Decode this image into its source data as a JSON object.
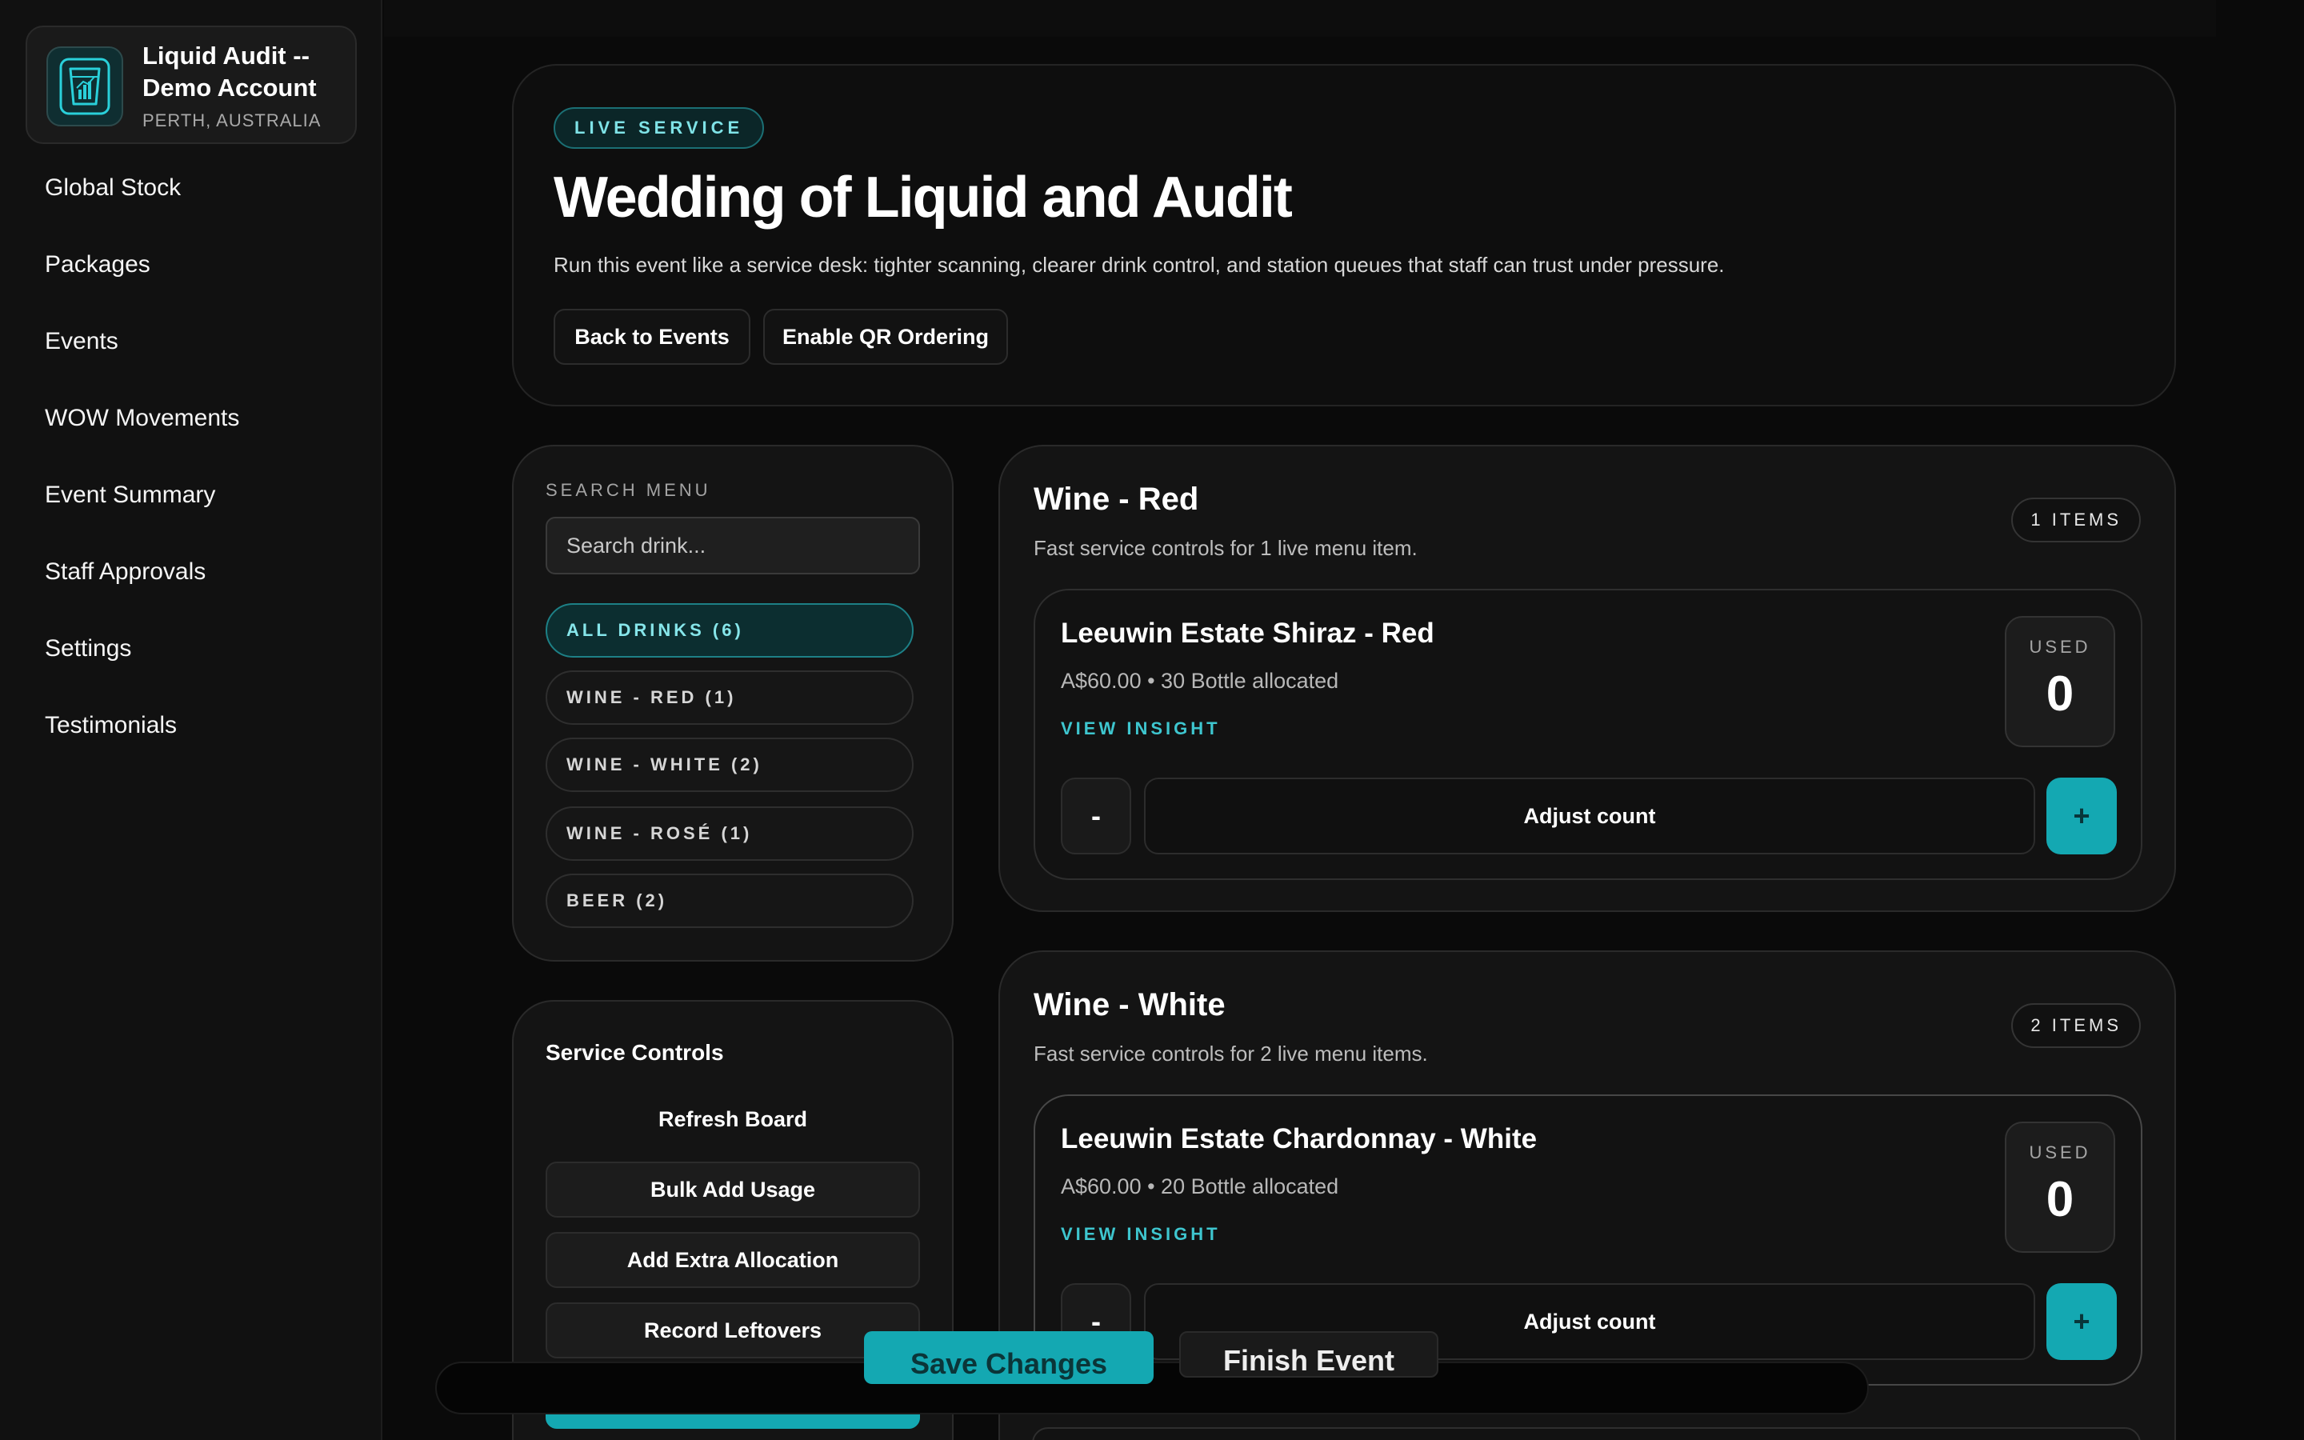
{
  "brand": {
    "name": "Liquid Audit -- Demo Account",
    "location": "PERTH, AUSTRALIA",
    "logo_icon": "glass-chart-icon"
  },
  "nav": {
    "items": [
      {
        "label": "Global Stock"
      },
      {
        "label": "Packages"
      },
      {
        "label": "Events"
      },
      {
        "label": "WOW Movements"
      },
      {
        "label": "Event Summary"
      },
      {
        "label": "Staff Approvals"
      },
      {
        "label": "Settings"
      },
      {
        "label": "Testimonials"
      }
    ]
  },
  "hero": {
    "badge": "LIVE SERVICE",
    "title": "Wedding of Liquid and Audit",
    "subtitle": "Run this event like a service desk: tighter scanning, clearer drink control, and station queues that staff can trust under pressure.",
    "back_label": "Back to Events",
    "qr_label": "Enable QR Ordering"
  },
  "search": {
    "label": "SEARCH MENU",
    "placeholder": "Search drink...",
    "categories": [
      {
        "label": "ALL DRINKS (6)",
        "active": true
      },
      {
        "label": "WINE - RED (1)"
      },
      {
        "label": "WINE - WHITE (2)"
      },
      {
        "label": "WINE - ROSÉ (1)"
      },
      {
        "label": "BEER (2)"
      }
    ]
  },
  "service": {
    "title": "Service Controls",
    "refresh": "Refresh Board",
    "bulk_add": "Bulk Add Usage",
    "extra_alloc": "Add Extra Allocation",
    "leftovers": "Record Leftovers"
  },
  "sections": [
    {
      "title": "Wine - Red",
      "subtitle": "Fast service controls for 1 live menu item.",
      "count": "1 ITEMS",
      "items": [
        {
          "name": "Leeuwin Estate Shiraz - Red",
          "meta": "A$60.00 • 30 Bottle allocated",
          "insight": "VIEW INSIGHT",
          "used_label": "USED",
          "used": "0",
          "minus": "-",
          "adjust_placeholder": "Adjust count",
          "plus": "+"
        }
      ]
    },
    {
      "title": "Wine - White",
      "subtitle": "Fast service controls for 2 live menu items.",
      "count": "2 ITEMS",
      "items": [
        {
          "name": "Leeuwin Estate Chardonnay - White",
          "meta": "A$60.00 • 20 Bottle allocated",
          "insight": "VIEW INSIGHT",
          "used_label": "USED",
          "used": "0",
          "minus": "-",
          "adjust_placeholder": "Adjust count",
          "plus": "+"
        }
      ]
    }
  ],
  "actions": {
    "save": "Save Changes",
    "finish": "Finish Event"
  },
  "colors": {
    "accent": "#14a8b2",
    "accent_text": "#3ec6cf",
    "background": "#0a0a0a",
    "panel": "#141414"
  }
}
